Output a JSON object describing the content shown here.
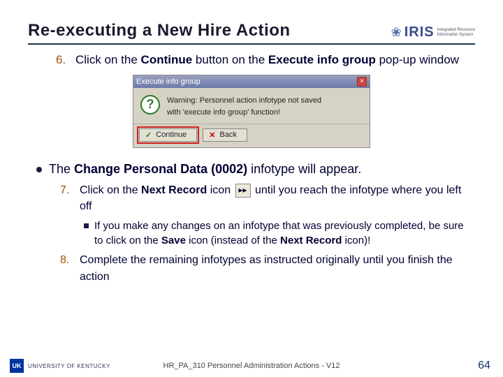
{
  "header": {
    "title": "Re-executing a New Hire Action",
    "logo_text": "IRIS",
    "logo_sub1": "Integrated Resource",
    "logo_sub2": "Information System"
  },
  "step6": {
    "num": "6.",
    "t1": "Click on the ",
    "b1": "Continue",
    "t2": " button on the ",
    "b2": "Execute info group",
    "t3": " pop-up window"
  },
  "popup": {
    "title": "Execute info group",
    "line1": "Warning: Personnel action infotype not saved",
    "line2": "with 'execute info group' function!",
    "continue": "Continue",
    "back": "Back",
    "question": "?",
    "close_x": "×",
    "check": "✓",
    "back_x": "✕"
  },
  "bullet_cpd": {
    "t1": "The ",
    "b1": "Change Personal Data (0002)",
    "t2": " infotype will appear."
  },
  "step7": {
    "num": "7.",
    "t1": "Click on the ",
    "b1": "Next Record",
    "t2": " icon ",
    "icon": "▸▸",
    "t3": " until you reach the infotype where you left off"
  },
  "subnote": {
    "t1": "If you make any changes on an infotype that was previously completed, be sure to click on the ",
    "b1": "Save",
    "t2": " icon (instead of the ",
    "b2": "Next Record",
    "t3": " icon)!"
  },
  "step8": {
    "num": "8.",
    "text": "Complete the remaining infotypes as instructed originally until you finish the action"
  },
  "footer": {
    "uk_abbr": "UK",
    "uk_name": "UNIVERSITY OF KENTUCKY",
    "center": "HR_PA_310 Personnel Administration Actions - V12",
    "page": "64"
  }
}
